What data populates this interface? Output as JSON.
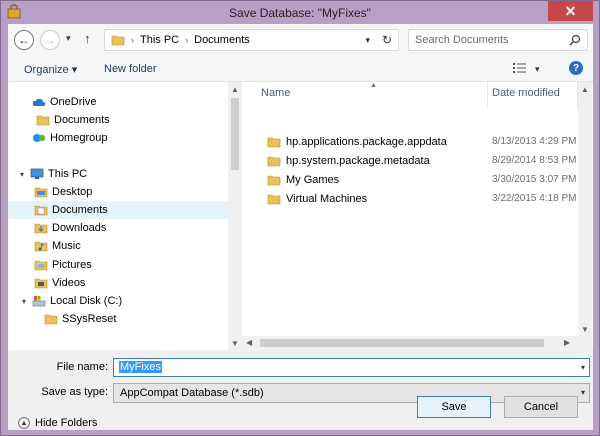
{
  "window": {
    "title": "Save Database: \"MyFixes\"",
    "close_glyph": "✕"
  },
  "address": {
    "crumbs": [
      "This PC",
      "Documents"
    ],
    "search_placeholder": "Search Documents"
  },
  "toolbar": {
    "organize_label": "Organize ▾",
    "new_folder_label": "New folder",
    "help_glyph": "?"
  },
  "nav": {
    "items": [
      {
        "label": "OneDrive",
        "icon": "cloud-icon"
      },
      {
        "label": "Documents",
        "icon": "folder-icon"
      },
      {
        "label": "Homegroup",
        "icon": "homegroup-icon"
      },
      {
        "label": "This PC",
        "icon": "computer-icon"
      },
      {
        "label": "Desktop",
        "icon": "folder-icon"
      },
      {
        "label": "Documents",
        "icon": "folder-icon",
        "selected": true
      },
      {
        "label": "Downloads",
        "icon": "folder-icon"
      },
      {
        "label": "Music",
        "icon": "folder-icon"
      },
      {
        "label": "Pictures",
        "icon": "folder-icon"
      },
      {
        "label": "Videos",
        "icon": "folder-icon"
      },
      {
        "label": "Local Disk (C:)",
        "icon": "drive-icon"
      },
      {
        "label": "SSysReset",
        "icon": "folder-icon"
      }
    ]
  },
  "files": {
    "col_name": "Name",
    "col_date": "Date modified",
    "rows": [
      {
        "name": "hp.applications.package.appdata",
        "date": "8/13/2013 4:29 PM"
      },
      {
        "name": "hp.system.package.metadata",
        "date": "8/29/2014 8:53 PM"
      },
      {
        "name": "My Games",
        "date": "3/30/2015 3:07 PM"
      },
      {
        "name": "Virtual Machines",
        "date": "3/22/2015 4:18 PM"
      }
    ]
  },
  "form": {
    "filename_label": "File name:",
    "filename_value": "MyFixes",
    "type_label": "Save as type:",
    "type_value": "AppCompat Database (*.sdb)"
  },
  "footer": {
    "hide_folders_label": "Hide Folders",
    "save_label": "Save",
    "cancel_label": "Cancel"
  },
  "colors": {
    "chrome": "#b89fc6",
    "close": "#c7484a",
    "folder": "#e9c05a",
    "selection": "#3399ff"
  }
}
